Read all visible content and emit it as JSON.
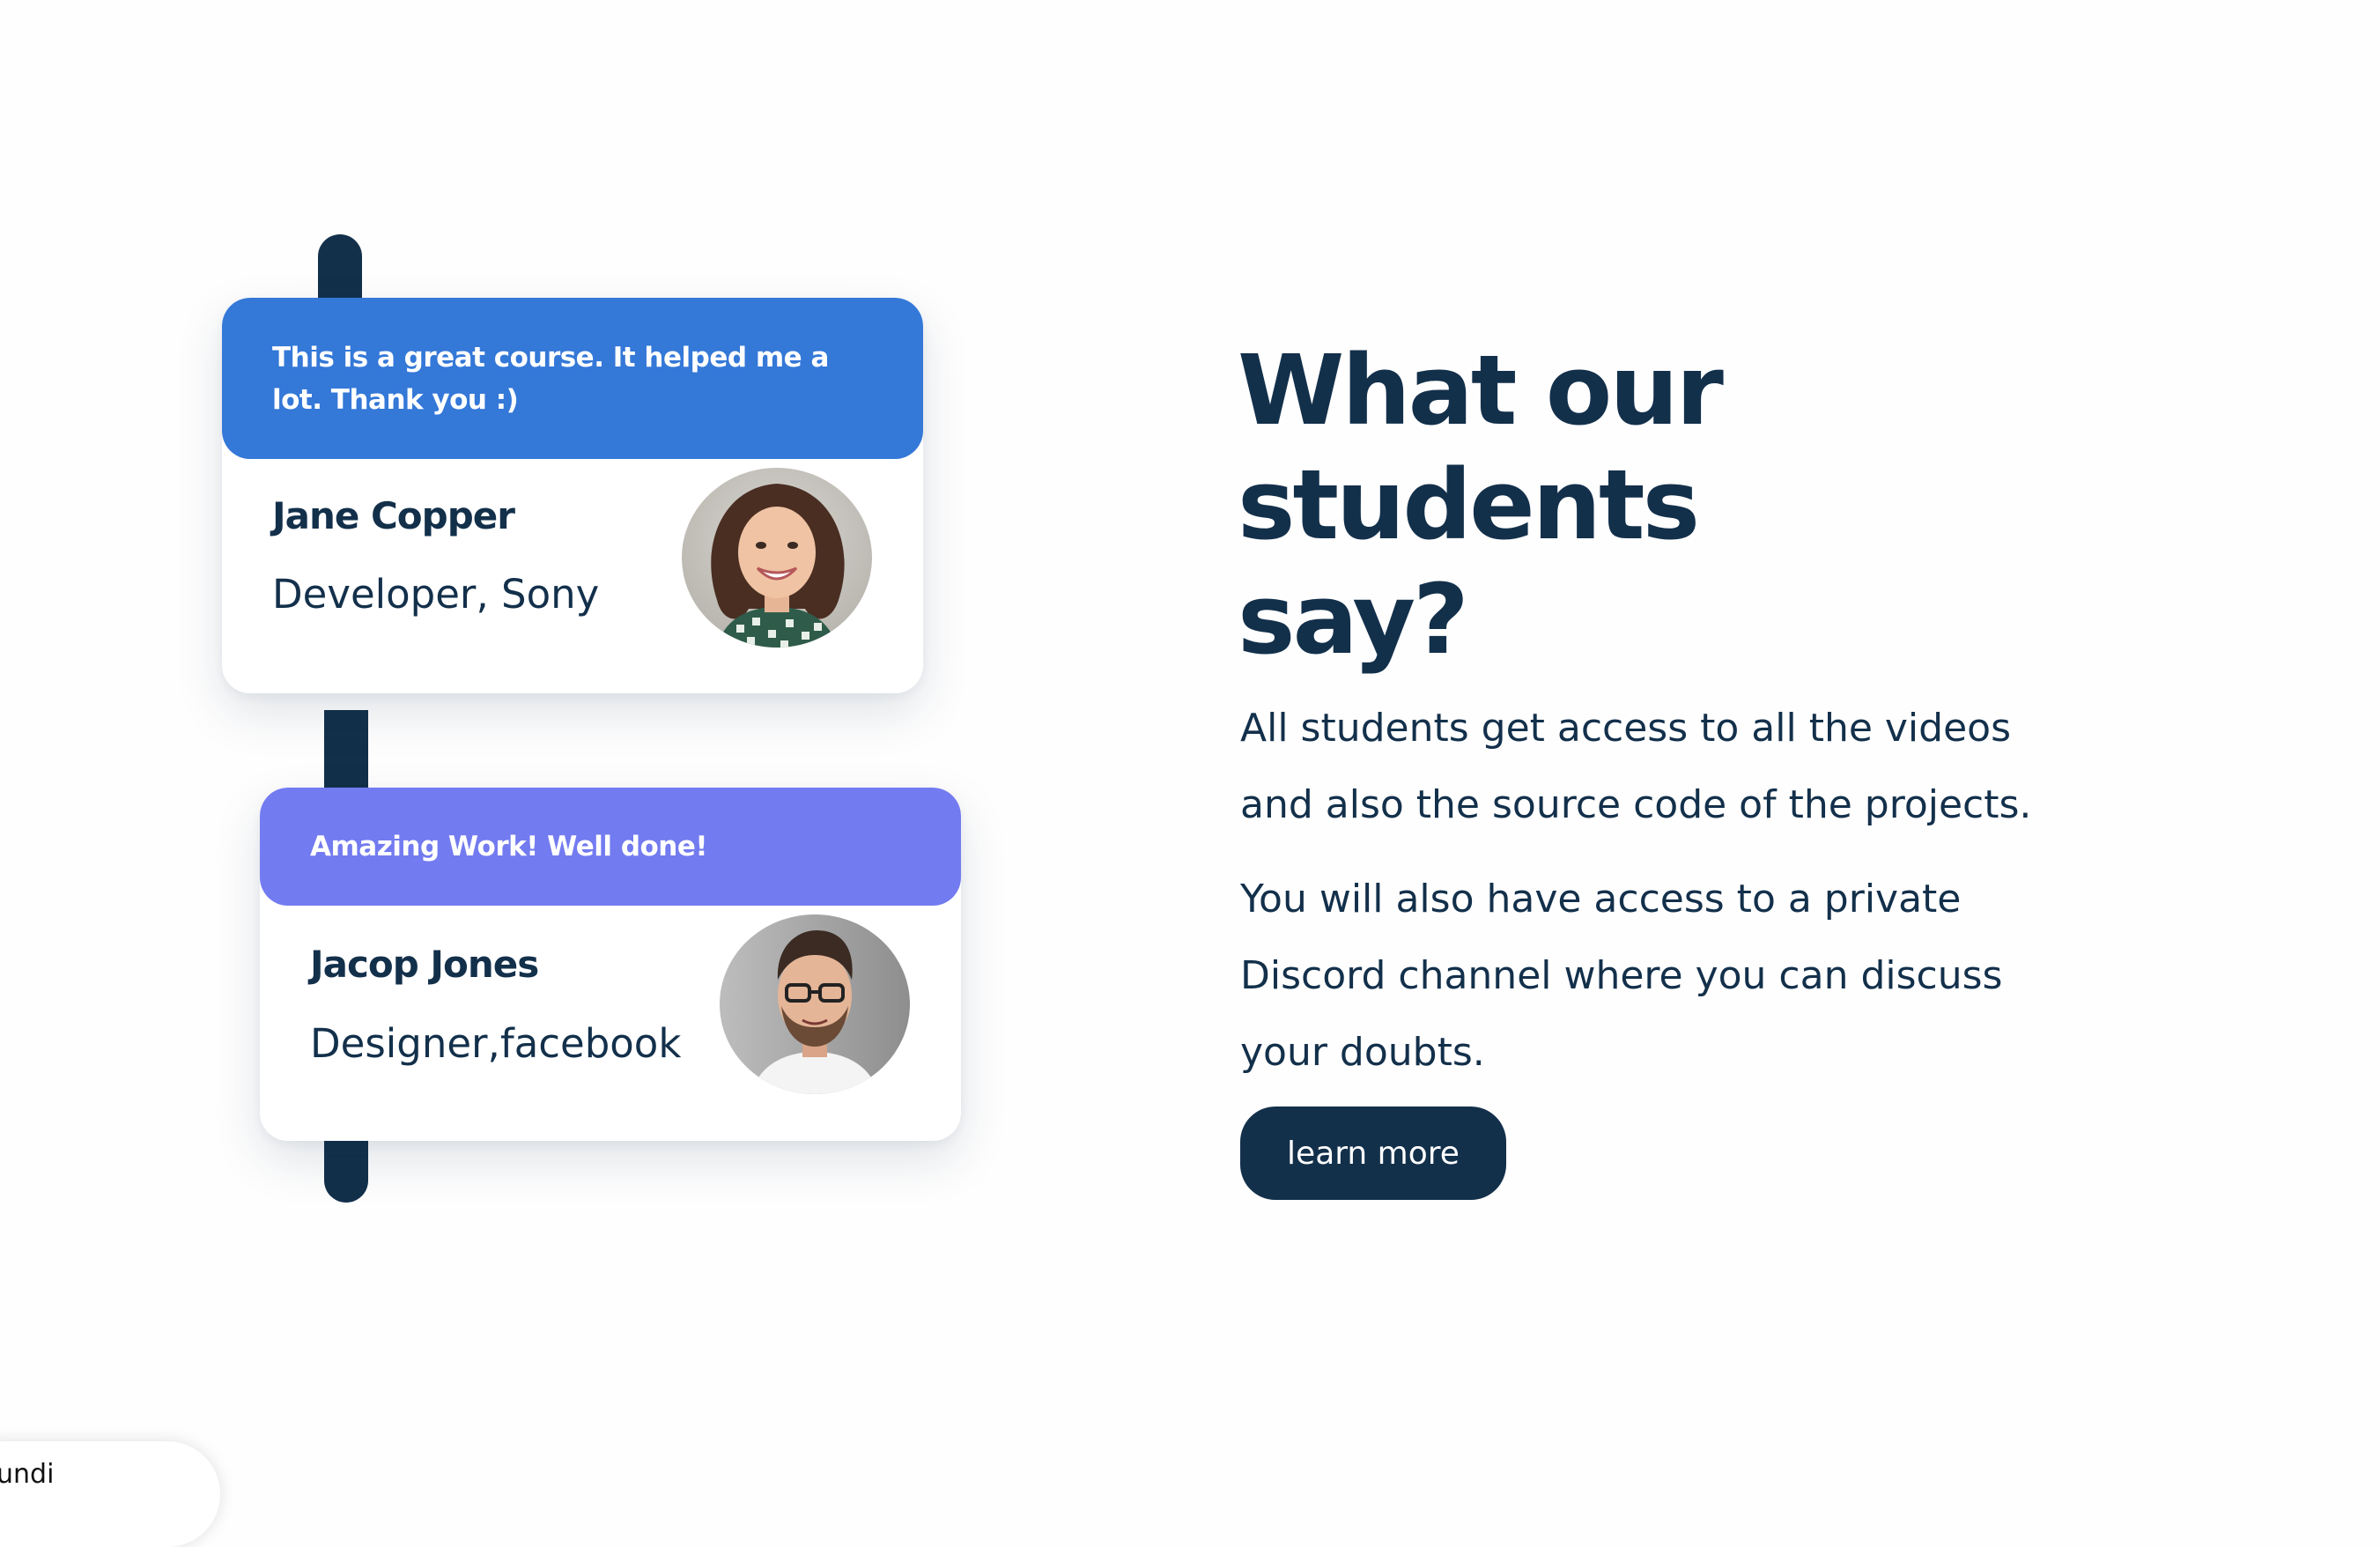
{
  "testimonials": [
    {
      "quote": "This is a great course. It helped me a lot. Thank you :)",
      "name": "Jane Copper",
      "role": "Developer, Sony",
      "accent": "#3478d8"
    },
    {
      "quote": "Amazing Work! Well done!",
      "name": "Jacop Jones",
      "role": "Designer,facebook",
      "accent": "#737bf0"
    }
  ],
  "section": {
    "heading": "What our students say?",
    "paragraph_1": "All students get access to all the videos and also the source code of the projects.",
    "paragraph_2": "You will also have access to a private Discord channel where you can discuss your doubts.",
    "button_label": "learn more"
  },
  "corner_widget": {
    "text": "undi"
  },
  "colors": {
    "primary_dark": "#13304b",
    "blue": "#3478d8",
    "purple": "#737bf0",
    "background": "#fefefe"
  }
}
